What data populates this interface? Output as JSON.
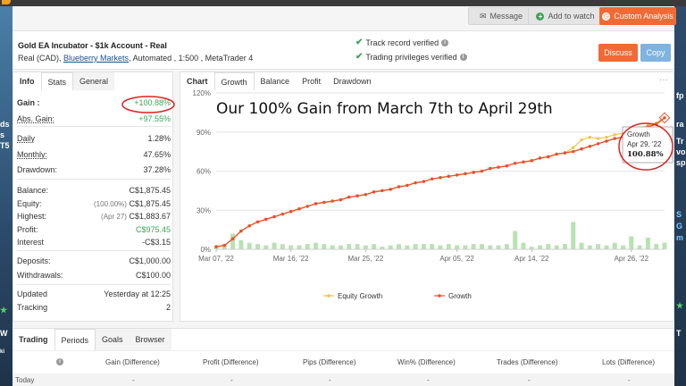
{
  "top_actions": {
    "message": "Message",
    "add_to_watch": "Add to watch",
    "custom_analysis": "Custom Analysis"
  },
  "account": {
    "title": "Gold EA Incubator - $1k Account - Real",
    "currency": "Real (CAD),",
    "broker": "Blueberry Markets",
    "details": ", Automated , 1:500 , MetaTrader 4",
    "verified_track": "Track record verified",
    "verified_trading": "Trading privileges verified",
    "discuss": "Discuss",
    "copy": "Copy"
  },
  "left_tabs": [
    "Info",
    "Stats",
    "General"
  ],
  "stats": {
    "gain_label": "Gain :",
    "gain_value": "+100.88%",
    "abs_gain_label": "Abs. Gain:",
    "abs_gain_value": "+97.55%",
    "daily_label": "Daily",
    "daily_value": "1.28%",
    "monthly_label": "Monthly:",
    "monthly_value": "47.65%",
    "drawdown_label": "Drawdown:",
    "drawdown_value": "37.28%",
    "balance_label": "Balance:",
    "balance_value": "C$1,875.45",
    "equity_label": "Equity:",
    "equity_note": "(100.00%)",
    "equity_value": "C$1,875.45",
    "highest_label": "Highest:",
    "highest_note": "(Apr 27)",
    "highest_value": "C$1,883.67",
    "profit_label": "Profit:",
    "profit_value": "C$975.45",
    "interest_label": "Interest",
    "interest_value": "-C$3.15",
    "deposits_label": "Deposits:",
    "deposits_value": "C$1,000.00",
    "withdrawals_label": "Withdrawals:",
    "withdrawals_value": "C$100.00",
    "updated_label": "Updated",
    "updated_value": "Yesterday at 12:25",
    "tracking_label": "Tracking",
    "tracking_value": "2"
  },
  "chart_tabs": [
    "Chart",
    "Growth",
    "Balance",
    "Profit",
    "Drawdown"
  ],
  "chart_menu": "···",
  "annotation": "Our 100% Gain from March 7th to April 29th",
  "tooltip": {
    "series": "Growth",
    "date": "Apr 29, '22",
    "value": "100.88%"
  },
  "legend": {
    "equity": "Equity Growth",
    "growth": "Growth"
  },
  "chart_data": {
    "type": "line",
    "title": "",
    "xlabel": "",
    "ylabel": "",
    "ylim": [
      0,
      120
    ],
    "y_ticks": [
      "0%",
      "30%",
      "60%",
      "90%",
      "120%"
    ],
    "x_ticks": [
      "Mar 07, '22",
      "Mar 16, '22",
      "Mar 25, '22",
      "Apr 05, '22",
      "Apr 14, '22",
      "Apr 26, '22"
    ],
    "x_tick_index": [
      0,
      9,
      18,
      29,
      38,
      50
    ],
    "n_days": 54,
    "series": [
      {
        "name": "Growth",
        "color": "#e8532a",
        "values": [
          2,
          3,
          8,
          14,
          18,
          21,
          23,
          25,
          27,
          29,
          31,
          33,
          35,
          36,
          37,
          38,
          40,
          41,
          42,
          44,
          45,
          46,
          48,
          49,
          51,
          52,
          54,
          55,
          56,
          57,
          58,
          59,
          60,
          62,
          63,
          64,
          66,
          67,
          68,
          70,
          71,
          73,
          74,
          75,
          77,
          79,
          81,
          83,
          85,
          86,
          88,
          91,
          94,
          96,
          100.88
        ]
      },
      {
        "name": "Equity Growth",
        "color": "#f3c140",
        "values": [
          null,
          null,
          null,
          null,
          null,
          null,
          null,
          null,
          null,
          null,
          null,
          null,
          null,
          null,
          null,
          null,
          null,
          null,
          null,
          null,
          null,
          null,
          null,
          null,
          null,
          null,
          null,
          null,
          null,
          null,
          null,
          null,
          null,
          null,
          null,
          null,
          null,
          null,
          null,
          null,
          null,
          null,
          74,
          78,
          84,
          86,
          85,
          86,
          88,
          89,
          90,
          93,
          95,
          97,
          100.88
        ]
      }
    ],
    "bars": {
      "color": "#b9e2b2",
      "values": [
        2,
        4,
        12,
        7,
        5,
        4,
        3,
        5,
        4,
        3,
        3,
        4,
        5,
        4,
        3,
        3,
        4,
        4,
        3,
        4,
        2,
        3,
        4,
        3,
        4,
        4,
        4,
        3,
        4,
        3,
        3,
        4,
        4,
        3,
        3,
        4,
        14,
        5,
        2,
        3,
        4,
        3,
        4,
        21,
        5,
        3,
        4,
        3,
        5,
        3,
        10,
        3,
        9,
        4,
        5
      ]
    }
  },
  "bottom_tabs": [
    "Trading",
    "Periods",
    "Goals",
    "Browser"
  ],
  "periods_table": {
    "headers": [
      "Gain (Difference)",
      "Profit (Difference)",
      "Pips (Difference)",
      "Win% (Difference)",
      "Trades (Difference)",
      "Lots (Difference)"
    ],
    "rows": [
      {
        "label": "Today",
        "cells": [
          "-",
          "-",
          "-",
          "-",
          "-",
          "-"
        ]
      }
    ]
  },
  "side_fragments": {
    "left": [
      "ds",
      "s",
      "T5",
      "★",
      "W",
      "ki"
    ],
    "right": [
      "fp",
      "ra",
      "Tr",
      "vo",
      "sp",
      "S",
      "G",
      "m",
      "★",
      "T"
    ]
  },
  "colors": {
    "orange": "#f06a35",
    "blue": "#7fb3e0",
    "green": "#3aa655",
    "annotation_red": "#e02020"
  }
}
